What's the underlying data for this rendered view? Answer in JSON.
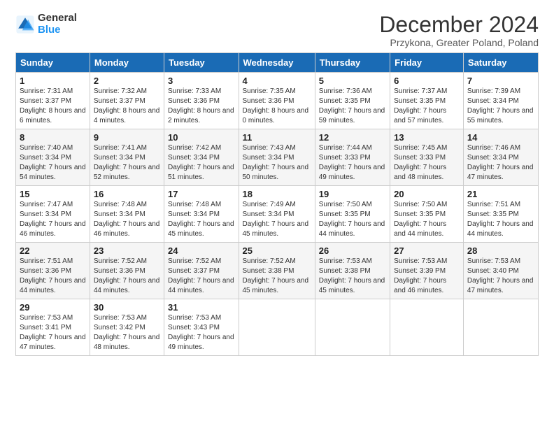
{
  "logo": {
    "general": "General",
    "blue": "Blue"
  },
  "title": "December 2024",
  "subtitle": "Przykona, Greater Poland, Poland",
  "days_of_week": [
    "Sunday",
    "Monday",
    "Tuesday",
    "Wednesday",
    "Thursday",
    "Friday",
    "Saturday"
  ],
  "weeks": [
    [
      {
        "day": 1,
        "sunrise": "7:31 AM",
        "sunset": "3:37 PM",
        "daylight": "8 hours and 6 minutes."
      },
      {
        "day": 2,
        "sunrise": "7:32 AM",
        "sunset": "3:37 PM",
        "daylight": "8 hours and 4 minutes."
      },
      {
        "day": 3,
        "sunrise": "7:33 AM",
        "sunset": "3:36 PM",
        "daylight": "8 hours and 2 minutes."
      },
      {
        "day": 4,
        "sunrise": "7:35 AM",
        "sunset": "3:36 PM",
        "daylight": "8 hours and 0 minutes."
      },
      {
        "day": 5,
        "sunrise": "7:36 AM",
        "sunset": "3:35 PM",
        "daylight": "7 hours and 59 minutes."
      },
      {
        "day": 6,
        "sunrise": "7:37 AM",
        "sunset": "3:35 PM",
        "daylight": "7 hours and 57 minutes."
      },
      {
        "day": 7,
        "sunrise": "7:39 AM",
        "sunset": "3:34 PM",
        "daylight": "7 hours and 55 minutes."
      }
    ],
    [
      {
        "day": 8,
        "sunrise": "7:40 AM",
        "sunset": "3:34 PM",
        "daylight": "7 hours and 54 minutes."
      },
      {
        "day": 9,
        "sunrise": "7:41 AM",
        "sunset": "3:34 PM",
        "daylight": "7 hours and 52 minutes."
      },
      {
        "day": 10,
        "sunrise": "7:42 AM",
        "sunset": "3:34 PM",
        "daylight": "7 hours and 51 minutes."
      },
      {
        "day": 11,
        "sunrise": "7:43 AM",
        "sunset": "3:34 PM",
        "daylight": "7 hours and 50 minutes."
      },
      {
        "day": 12,
        "sunrise": "7:44 AM",
        "sunset": "3:33 PM",
        "daylight": "7 hours and 49 minutes."
      },
      {
        "day": 13,
        "sunrise": "7:45 AM",
        "sunset": "3:33 PM",
        "daylight": "7 hours and 48 minutes."
      },
      {
        "day": 14,
        "sunrise": "7:46 AM",
        "sunset": "3:34 PM",
        "daylight": "7 hours and 47 minutes."
      }
    ],
    [
      {
        "day": 15,
        "sunrise": "7:47 AM",
        "sunset": "3:34 PM",
        "daylight": "7 hours and 46 minutes."
      },
      {
        "day": 16,
        "sunrise": "7:48 AM",
        "sunset": "3:34 PM",
        "daylight": "7 hours and 46 minutes."
      },
      {
        "day": 17,
        "sunrise": "7:48 AM",
        "sunset": "3:34 PM",
        "daylight": "7 hours and 45 minutes."
      },
      {
        "day": 18,
        "sunrise": "7:49 AM",
        "sunset": "3:34 PM",
        "daylight": "7 hours and 45 minutes."
      },
      {
        "day": 19,
        "sunrise": "7:50 AM",
        "sunset": "3:35 PM",
        "daylight": "7 hours and 44 minutes."
      },
      {
        "day": 20,
        "sunrise": "7:50 AM",
        "sunset": "3:35 PM",
        "daylight": "7 hours and 44 minutes."
      },
      {
        "day": 21,
        "sunrise": "7:51 AM",
        "sunset": "3:35 PM",
        "daylight": "7 hours and 44 minutes."
      }
    ],
    [
      {
        "day": 22,
        "sunrise": "7:51 AM",
        "sunset": "3:36 PM",
        "daylight": "7 hours and 44 minutes."
      },
      {
        "day": 23,
        "sunrise": "7:52 AM",
        "sunset": "3:36 PM",
        "daylight": "7 hours and 44 minutes."
      },
      {
        "day": 24,
        "sunrise": "7:52 AM",
        "sunset": "3:37 PM",
        "daylight": "7 hours and 44 minutes."
      },
      {
        "day": 25,
        "sunrise": "7:52 AM",
        "sunset": "3:38 PM",
        "daylight": "7 hours and 45 minutes."
      },
      {
        "day": 26,
        "sunrise": "7:53 AM",
        "sunset": "3:38 PM",
        "daylight": "7 hours and 45 minutes."
      },
      {
        "day": 27,
        "sunrise": "7:53 AM",
        "sunset": "3:39 PM",
        "daylight": "7 hours and 46 minutes."
      },
      {
        "day": 28,
        "sunrise": "7:53 AM",
        "sunset": "3:40 PM",
        "daylight": "7 hours and 47 minutes."
      }
    ],
    [
      {
        "day": 29,
        "sunrise": "7:53 AM",
        "sunset": "3:41 PM",
        "daylight": "7 hours and 47 minutes."
      },
      {
        "day": 30,
        "sunrise": "7:53 AM",
        "sunset": "3:42 PM",
        "daylight": "7 hours and 48 minutes."
      },
      {
        "day": 31,
        "sunrise": "7:53 AM",
        "sunset": "3:43 PM",
        "daylight": "7 hours and 49 minutes."
      },
      null,
      null,
      null,
      null
    ]
  ],
  "labels": {
    "sunrise": "Sunrise:",
    "sunset": "Sunset:",
    "daylight": "Daylight:"
  }
}
